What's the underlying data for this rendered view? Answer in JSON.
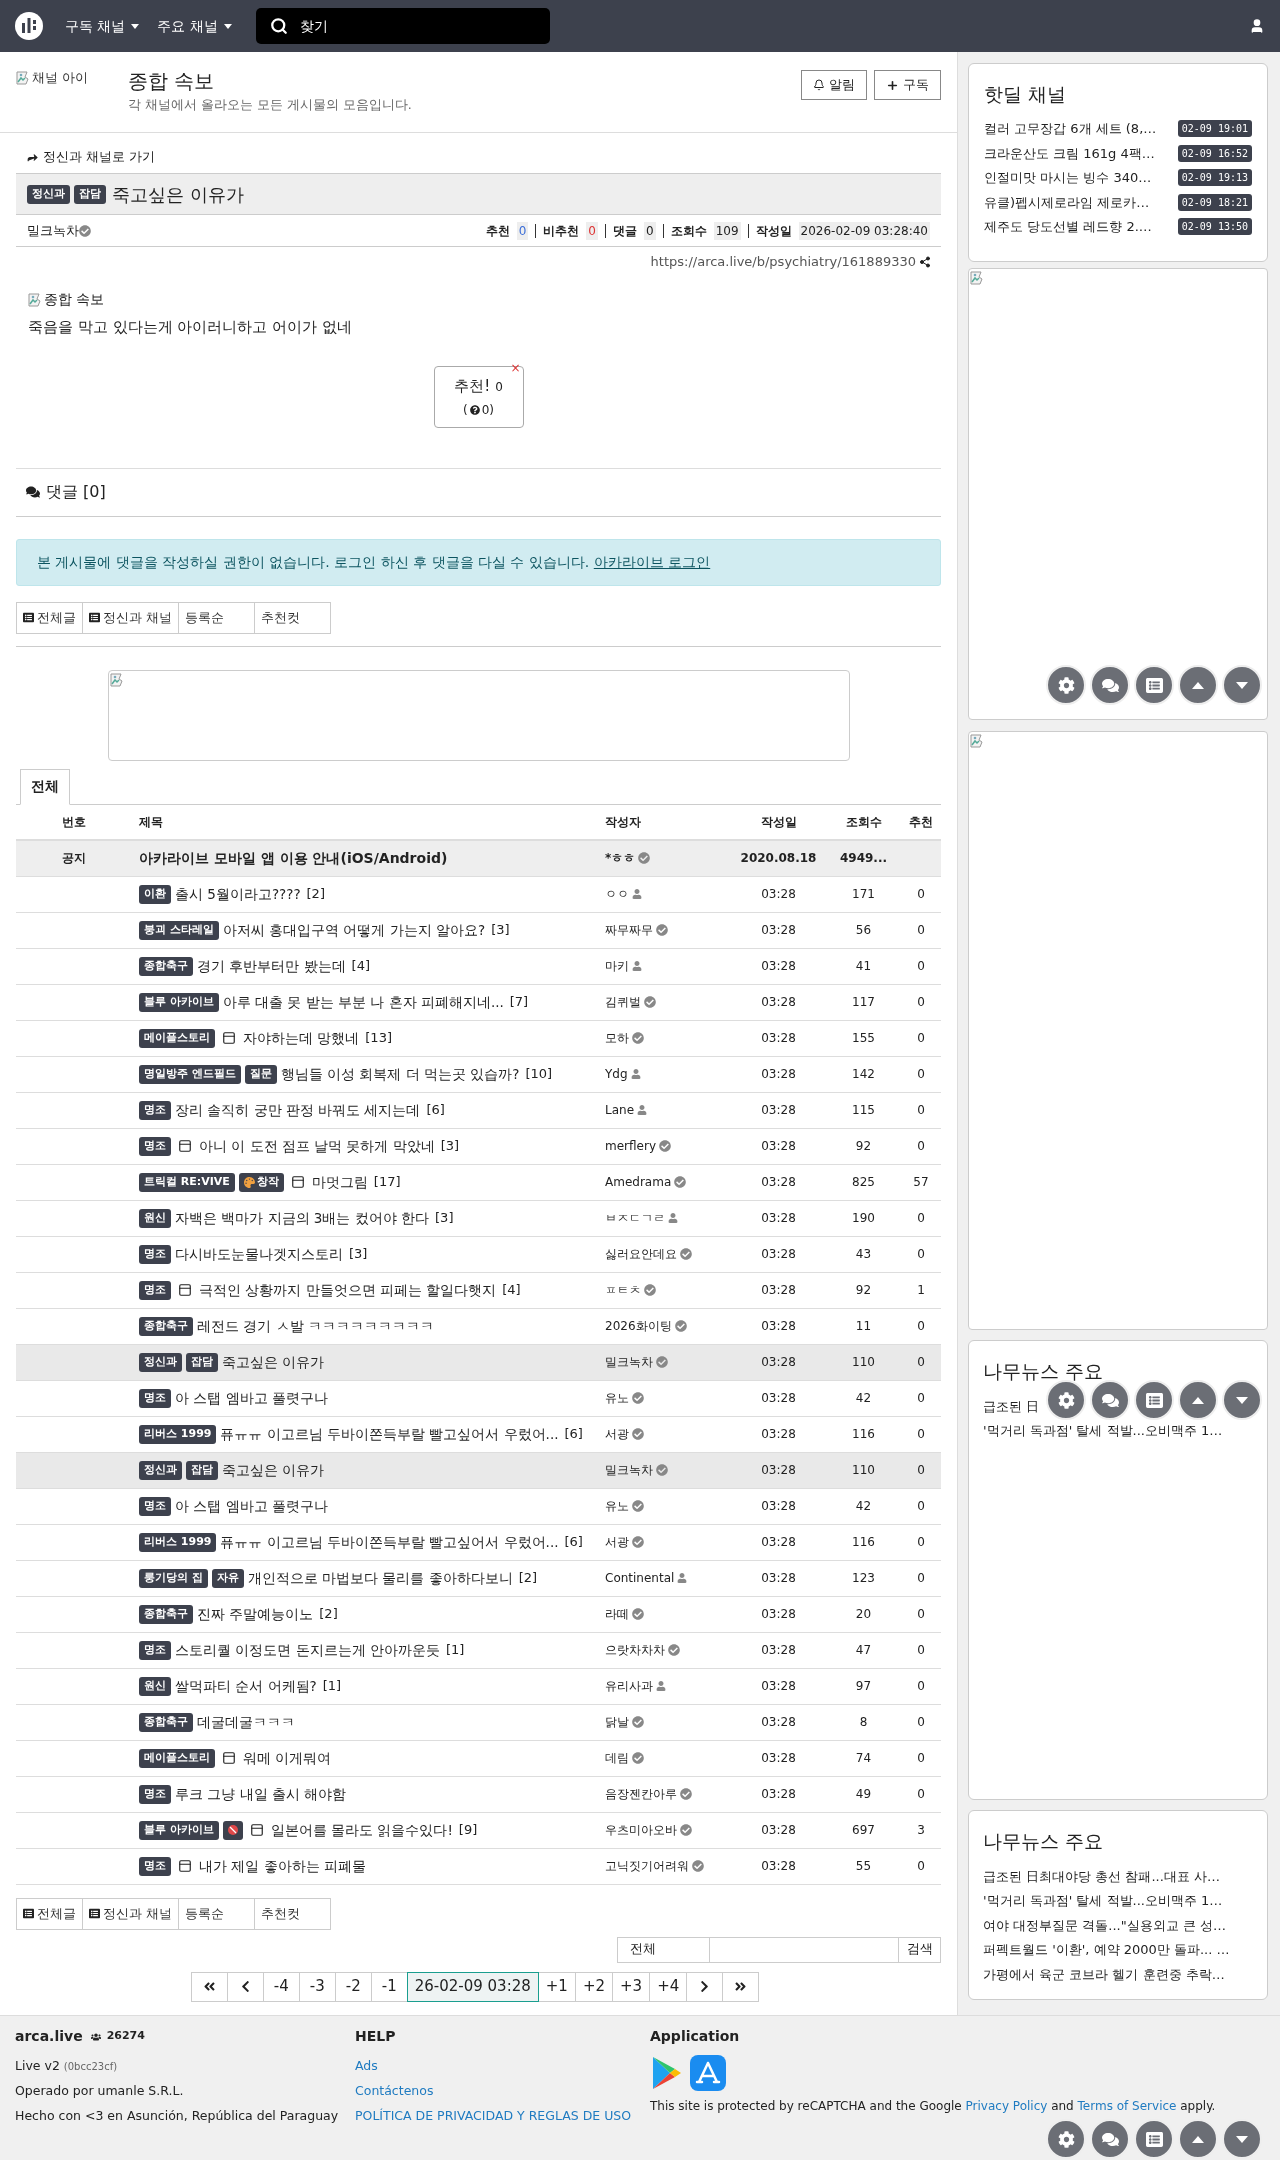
{
  "navbar": {
    "menus": [
      {
        "label": "구독 채널"
      },
      {
        "label": "주요 채널"
      }
    ],
    "search": {
      "placeholder": "찾기"
    }
  },
  "channel": {
    "icon_alt": "채널 아이",
    "title": "종합 속보",
    "description": "각 채널에서 올라오는 모든 게시물의 모음입니다.",
    "buttons": [
      {
        "kind": "bell",
        "label": "알림"
      },
      {
        "kind": "plus",
        "label": "구독"
      }
    ]
  },
  "article": {
    "back_link": "정신과 채널로 가기",
    "tags": [
      {
        "label": "정신과"
      },
      {
        "label": "잡담"
      }
    ],
    "title": "죽고싶은 이유가",
    "author": "밀크녹차",
    "stats": [
      {
        "label": "추천",
        "value": "0",
        "color": "#3d6fd8"
      },
      {
        "label": "비추천",
        "value": "0",
        "color": "#dd3333"
      },
      {
        "label": "댓글",
        "value": "0",
        "color": "#222222"
      },
      {
        "label": "조회수",
        "value": "109",
        "color": "#222222"
      },
      {
        "label": "작성일",
        "value": "2026-02-09 03:28:40",
        "color": "#222222"
      }
    ],
    "url": "https://arca.live/b/psychiatry/161889330",
    "image_alt": "종합 속보",
    "body": "죽음을 막고 있다는게 아이러니하고 어이가 없네",
    "vote": {
      "label": "추천!",
      "count": "0",
      "sub_open": "(",
      "sub_count": "0)",
      "close": "×"
    }
  },
  "comments": {
    "heading": "댓글 [0]",
    "notice": "본 게시물에 댓글을 작성하실 권한이 없습니다. 로그인 하신 후 댓글을 다실 수 있습니다.",
    "login_link": "아카라이브 로그인"
  },
  "filters": [
    {
      "label": "전체글",
      "icon": true
    },
    {
      "label": "정신과 채널",
      "icon": true
    },
    {
      "label": "등록순",
      "icon": false
    },
    {
      "label": "추천컷",
      "icon": false
    }
  ],
  "tabs": [
    {
      "label": "전체",
      "selected": true
    }
  ],
  "table": {
    "columns": [
      "번호",
      "제목",
      "작성자",
      "작성일",
      "조회수",
      "추천"
    ],
    "rows": [
      {
        "kind": "notice",
        "number": "공지",
        "tags": [],
        "image": false,
        "title": "아카라이브 모바일 앱 이용 안내(iOS/Android)",
        "comments": "",
        "author": "*ㅎㅎ",
        "member": true,
        "date": "2020.08.18",
        "views": "4949...",
        "votes": "",
        "selected": false
      },
      {
        "kind": "post",
        "tags": [
          {
            "label": "이환"
          }
        ],
        "image": false,
        "title": "출시 5월이라고????",
        "comments": "[2]",
        "author": "ㅇㅇ",
        "member": false,
        "date": "03:28",
        "views": "171",
        "votes": "0",
        "selected": false
      },
      {
        "kind": "post",
        "tags": [
          {
            "label": "붕괴 스타레일"
          }
        ],
        "image": false,
        "title": "아저씨 홍대입구역 어떻게 가는지 알아요?",
        "comments": "[3]",
        "author": "짜무짜무",
        "member": true,
        "date": "03:28",
        "views": "56",
        "votes": "0",
        "selected": false
      },
      {
        "kind": "post",
        "tags": [
          {
            "label": "종합축구"
          }
        ],
        "image": false,
        "title": "경기 후반부터만 봤는데",
        "comments": "[4]",
        "author": "마키",
        "member": false,
        "date": "03:28",
        "views": "41",
        "votes": "0",
        "selected": false
      },
      {
        "kind": "post",
        "tags": [
          {
            "label": "블루 아카이브"
          }
        ],
        "image": false,
        "title": "아루 대출 못 받는 부분 나 혼자 피폐해지네...",
        "comments": "[7]",
        "author": "김퀴벌",
        "member": true,
        "date": "03:28",
        "views": "117",
        "votes": "0",
        "selected": false
      },
      {
        "kind": "post",
        "tags": [
          {
            "label": "메이플스토리"
          }
        ],
        "image": true,
        "title": "자야하는데 망했네",
        "comments": "[13]",
        "author": "모하",
        "member": true,
        "date": "03:28",
        "views": "155",
        "votes": "0",
        "selected": false
      },
      {
        "kind": "post",
        "tags": [
          {
            "label": "명일방주 엔드필드"
          },
          {
            "label": "질문"
          }
        ],
        "image": false,
        "title": "행님들 이성 회복제 더 먹는곳 있습까?",
        "comments": "[10]",
        "author": "Ydg",
        "member": false,
        "date": "03:28",
        "views": "142",
        "votes": "0",
        "selected": false
      },
      {
        "kind": "post",
        "tags": [
          {
            "label": "명조"
          }
        ],
        "image": false,
        "title": "장리 솔직히 궁만 판정 바꿔도 세지는데",
        "comments": "[6]",
        "author": "Lane",
        "member": false,
        "date": "03:28",
        "views": "115",
        "votes": "0",
        "selected": false
      },
      {
        "kind": "post",
        "tags": [
          {
            "label": "명조"
          }
        ],
        "image": true,
        "title": "아니 이 도전 점프 날먹 못하게 막았네",
        "comments": "[3]",
        "author": "merflery",
        "member": true,
        "date": "03:28",
        "views": "92",
        "votes": "0",
        "selected": false
      },
      {
        "kind": "post",
        "tags": [
          {
            "label": "트릭컬 RE:VIVE"
          },
          {
            "label": "창작",
            "kind": "palette"
          }
        ],
        "image": true,
        "title": "마멋그림",
        "comments": "[17]",
        "author": "Amedrama",
        "member": true,
        "date": "03:28",
        "views": "825",
        "votes": "57",
        "selected": false
      },
      {
        "kind": "post",
        "tags": [
          {
            "label": "원신"
          }
        ],
        "image": false,
        "title": "자백은 백마가 지금의 3배는 컸어야 한다",
        "comments": "[3]",
        "author": "ㅂㅈㄷㄱㄹ",
        "member": false,
        "date": "03:28",
        "views": "190",
        "votes": "0",
        "selected": false
      },
      {
        "kind": "post",
        "tags": [
          {
            "label": "명조"
          }
        ],
        "image": false,
        "title": "다시바도눈물나겟지스토리",
        "comments": "[3]",
        "author": "싫러요안데요",
        "member": true,
        "date": "03:28",
        "views": "43",
        "votes": "0",
        "selected": false
      },
      {
        "kind": "post",
        "tags": [
          {
            "label": "명조"
          }
        ],
        "image": true,
        "title": "극적인 상황까지 만들엇으면 피페는 할일다햇지",
        "comments": "[4]",
        "author": "ㅍㅌㅊ",
        "member": true,
        "date": "03:28",
        "views": "92",
        "votes": "1",
        "selected": false
      },
      {
        "kind": "post",
        "tags": [
          {
            "label": "종합축구"
          }
        ],
        "image": false,
        "title": "레전드 경기 ㅅ발 ㅋㅋㅋㅋㅋㅋㅋㅋㅋ",
        "comments": "",
        "author": "2026화이팅",
        "member": true,
        "date": "03:28",
        "views": "11",
        "votes": "0",
        "selected": false
      },
      {
        "kind": "post",
        "tags": [
          {
            "label": "정신과"
          },
          {
            "label": "잡담"
          }
        ],
        "image": false,
        "title": "죽고싶은 이유가",
        "comments": "",
        "author": "밀크녹차",
        "member": true,
        "date": "03:28",
        "views": "110",
        "votes": "0",
        "selected": true
      },
      {
        "kind": "post",
        "tags": [
          {
            "label": "명조"
          }
        ],
        "image": false,
        "title": "아 스탭 엠바고 풀렷구나",
        "comments": "",
        "author": "유노",
        "member": true,
        "date": "03:28",
        "views": "42",
        "votes": "0",
        "selected": false
      },
      {
        "kind": "post",
        "tags": [
          {
            "label": "리버스 1999"
          }
        ],
        "image": false,
        "title": "퓨ㅠㅠ 이고르님 두바이쫀득부랄 빨고싶어서 우렀어...",
        "comments": "[6]",
        "author": "서광",
        "member": true,
        "date": "03:28",
        "views": "116",
        "votes": "0",
        "selected": false
      },
      {
        "kind": "post",
        "tags": [
          {
            "label": "정신과"
          },
          {
            "label": "잡담"
          }
        ],
        "image": false,
        "title": "죽고싶은 이유가",
        "comments": "",
        "author": "밀크녹차",
        "member": true,
        "date": "03:28",
        "views": "110",
        "votes": "0",
        "selected": true
      },
      {
        "kind": "post",
        "tags": [
          {
            "label": "명조"
          }
        ],
        "image": false,
        "title": "아 스탭 엠바고 풀렷구나",
        "comments": "",
        "author": "유노",
        "member": true,
        "date": "03:28",
        "views": "42",
        "votes": "0",
        "selected": false
      },
      {
        "kind": "post",
        "tags": [
          {
            "label": "리버스 1999"
          }
        ],
        "image": false,
        "title": "퓨ㅠㅠ 이고르님 두바이쫀득부랄 빨고싶어서 우렀어...",
        "comments": "[6]",
        "author": "서광",
        "member": true,
        "date": "03:28",
        "views": "116",
        "votes": "0",
        "selected": false
      },
      {
        "kind": "post",
        "tags": [
          {
            "label": "룽기당의 집"
          },
          {
            "label": "자유"
          }
        ],
        "image": false,
        "title": "개인적으로 마법보다 물리를 좋아하다보니",
        "comments": "[2]",
        "author": "Continental",
        "member": false,
        "date": "03:28",
        "views": "123",
        "votes": "0",
        "selected": false
      },
      {
        "kind": "post",
        "tags": [
          {
            "label": "종합축구"
          }
        ],
        "image": false,
        "title": "진짜 주말예능이노",
        "comments": "[2]",
        "author": "라떼",
        "member": true,
        "date": "03:28",
        "views": "20",
        "votes": "0",
        "selected": false
      },
      {
        "kind": "post",
        "tags": [
          {
            "label": "명조"
          }
        ],
        "image": false,
        "title": "스토리퀄 이정도면 돈지르는게 안아까운듯",
        "comments": "[1]",
        "author": "으랏차차차",
        "member": true,
        "date": "03:28",
        "views": "47",
        "votes": "0",
        "selected": false
      },
      {
        "kind": "post",
        "tags": [
          {
            "label": "원신"
          }
        ],
        "image": false,
        "title": "쌀먹파티 순서 어케됨?",
        "comments": "[1]",
        "author": "유리사과",
        "member": false,
        "date": "03:28",
        "views": "97",
        "votes": "0",
        "selected": false
      },
      {
        "kind": "post",
        "tags": [
          {
            "label": "종합축구"
          }
        ],
        "image": false,
        "title": "데굴데굴ㅋㅋㅋ",
        "comments": "",
        "author": "닭날",
        "member": true,
        "date": "03:28",
        "views": "8",
        "votes": "0",
        "selected": false
      },
      {
        "kind": "post",
        "tags": [
          {
            "label": "메이플스토리"
          }
        ],
        "image": true,
        "title": "워메 이게뭐여",
        "comments": "",
        "author": "데림",
        "member": true,
        "date": "03:28",
        "views": "74",
        "votes": "0",
        "selected": false
      },
      {
        "kind": "post",
        "tags": [
          {
            "label": "명조"
          }
        ],
        "image": false,
        "title": "루크 그냥 내일 출시 해야함",
        "comments": "",
        "author": "음장젠칸아루",
        "member": true,
        "date": "03:28",
        "views": "49",
        "votes": "0",
        "selected": false
      },
      {
        "kind": "post",
        "tags": [
          {
            "label": "블루 아카이브"
          },
          {
            "kind": "adult"
          }
        ],
        "image": true,
        "title": "일본어를 몰라도 읽을수있다!",
        "comments": "[9]",
        "author": "우츠미아오바",
        "member": true,
        "date": "03:28",
        "views": "697",
        "votes": "3",
        "selected": false
      },
      {
        "kind": "post",
        "tags": [
          {
            "label": "명조"
          }
        ],
        "image": true,
        "title": "내가 제일 좋아하는 피폐물",
        "comments": "",
        "author": "고닉짓기어려워",
        "member": true,
        "date": "03:28",
        "views": "55",
        "votes": "0",
        "selected": false
      }
    ]
  },
  "bottom_filters": [
    {
      "label": "전체글",
      "icon": true
    },
    {
      "label": "정신과 채널",
      "icon": true
    },
    {
      "label": "등록순",
      "icon": false
    },
    {
      "label": "추천컷",
      "icon": false
    }
  ],
  "search": {
    "scope": "전체",
    "button": "검색"
  },
  "pagination": [
    {
      "kind": "first",
      "selected": false
    },
    {
      "kind": "prev",
      "selected": false
    },
    {
      "kind": "page",
      "label": "-4",
      "selected": false
    },
    {
      "kind": "page",
      "label": "-3",
      "selected": false
    },
    {
      "kind": "page",
      "label": "-2",
      "selected": false
    },
    {
      "kind": "page",
      "label": "-1",
      "selected": false
    },
    {
      "kind": "page",
      "label": "26-02-09 03:28",
      "selected": true
    },
    {
      "kind": "page",
      "label": "+1",
      "selected": false
    },
    {
      "kind": "page",
      "label": "+2",
      "selected": false
    },
    {
      "kind": "page",
      "label": "+3",
      "selected": false
    },
    {
      "kind": "page",
      "label": "+4",
      "selected": false
    },
    {
      "kind": "next",
      "selected": false
    },
    {
      "kind": "last",
      "selected": false
    }
  ],
  "sidebar": {
    "hotdeal": {
      "title": "핫딜 채널",
      "items": [
        {
          "title": "컬러 고무장갑 6개 세트 (8,…",
          "time": "02-09 19:01"
        },
        {
          "title": "크라운산도 크림 161g 4팩…",
          "time": "02-09 16:52"
        },
        {
          "title": "인절미맛 마시는 빙수 340…",
          "time": "02-09 19:13"
        },
        {
          "title": "유클)펩시제로라임 제로카…",
          "time": "02-09 18:21"
        },
        {
          "title": "제주도 당도선별 레드향 2.…",
          "time": "02-09 13:50"
        }
      ]
    },
    "news": [
      {
        "title": "나무뉴스 주요",
        "items": [
          "급조된 日",
          "'먹거리 독과점' 탈세 적발...오비맥주 1…"
        ]
      },
      {
        "title": "나무뉴스 주요",
        "items": [
          "급조된 日최대야당 총선 참패...대표 사…",
          "'먹거리 독과점' 탈세 적발...오비맥주 1…",
          "여야 대정부질문 격돌...\"실용외교 큰 성…",
          "퍼펙트월드 '이환', 예약 2000만 돌파... …",
          "가평에서 육군 코브라 헬기 훈련중 추락…"
        ]
      }
    ]
  },
  "footer": {
    "site": "arca.live",
    "users": "26274",
    "version": "Live v2",
    "build": "(0bcc23cf)",
    "operator": "Operado por umanle S.R.L.",
    "made": "Hecho con <3 en Asunción, República del Paraguay",
    "help_title": "HELP",
    "help_links": [
      "Ads",
      "Contáctenos",
      "POLÍTICA DE PRIVACIDAD Y REGLAS DE USO"
    ],
    "app_title": "Application",
    "recaptcha": [
      "This site is protected by reCAPTCHA and the Google ",
      "Privacy Policy",
      " and ",
      "Terms of Service",
      " apply."
    ]
  }
}
